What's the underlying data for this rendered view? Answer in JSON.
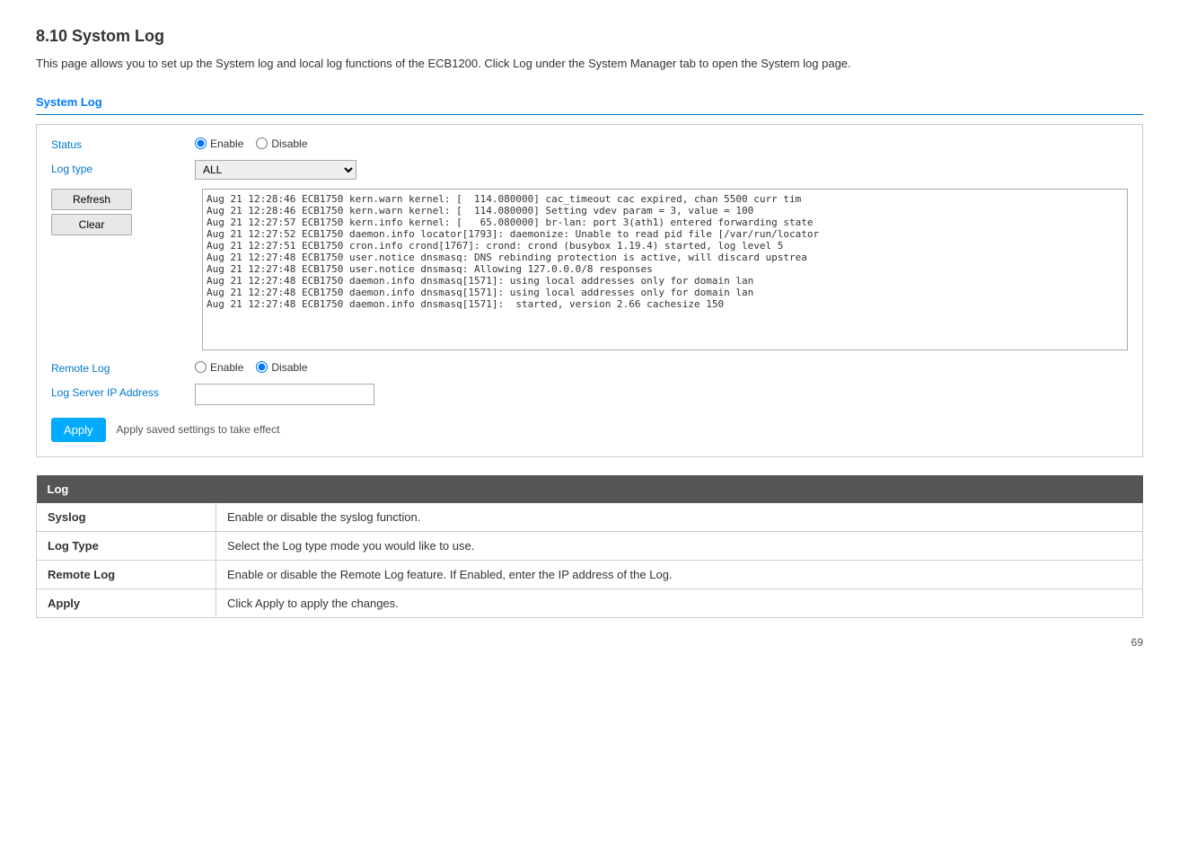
{
  "page": {
    "heading": "8.10 Systom Log",
    "intro": "This  page  allows  you  to  set  up  the  System  log  and  local  log  functions  of  the  ECB1200.  Click  Log  under  the  System Manager tab to open the System log page.",
    "section_title": "System Log",
    "status_label": "Status",
    "status_enable": "Enable",
    "status_disable": "Disable",
    "log_type_label": "Log type",
    "log_type_value": "ALL",
    "refresh_label": "Refresh",
    "clear_label": "Clear",
    "log_content": "Aug 21 12:28:46 ECB1750 kern.warn kernel: [  114.080000] cac_timeout cac expired, chan 5500 curr tim\nAug 21 12:28:46 ECB1750 kern.warn kernel: [  114.080000] Setting vdev param = 3, value = 100\nAug 21 12:27:57 ECB1750 kern.info kernel: [   65.080000] br-lan: port 3(ath1) entered forwarding state\nAug 21 12:27:52 ECB1750 daemon.info locator[1793]: daemonize: Unable to read pid file [/var/run/locator\nAug 21 12:27:51 ECB1750 cron.info crond[1767]: crond: crond (busybox 1.19.4) started, log level 5\nAug 21 12:27:48 ECB1750 user.notice dnsmasq: DNS rebinding protection is active, will discard upstrea\nAug 21 12:27:48 ECB1750 user.notice dnsmasq: Allowing 127.0.0.0/8 responses\nAug 21 12:27:48 ECB1750 daemon.info dnsmasq[1571]: using local addresses only for domain lan\nAug 21 12:27:48 ECB1750 daemon.info dnsmasq[1571]: using local addresses only for domain lan\nAug 21 12:27:48 ECB1750 daemon.info dnsmasq[1571]:  started, version 2.66 cachesize 150",
    "remote_log_label": "Remote Log",
    "remote_enable": "Enable",
    "remote_disable": "Disable",
    "log_server_ip_label": "Log Server IP Address",
    "log_server_ip_value": "",
    "apply_label": "Apply",
    "apply_note": "Apply saved settings to take effect",
    "table": {
      "header": "Log",
      "rows": [
        {
          "term": "Syslog",
          "description": "Enable or disable the syslog function."
        },
        {
          "term": "Log Type",
          "description": "Select the Log type mode you would like to use."
        },
        {
          "term": "Remote Log",
          "description": "Enable or disable the Remote Log feature. If Enabled, enter the IP address of the Log."
        },
        {
          "term": "Apply",
          "description": "Click Apply to apply the changes."
        }
      ]
    },
    "page_number": "69"
  }
}
